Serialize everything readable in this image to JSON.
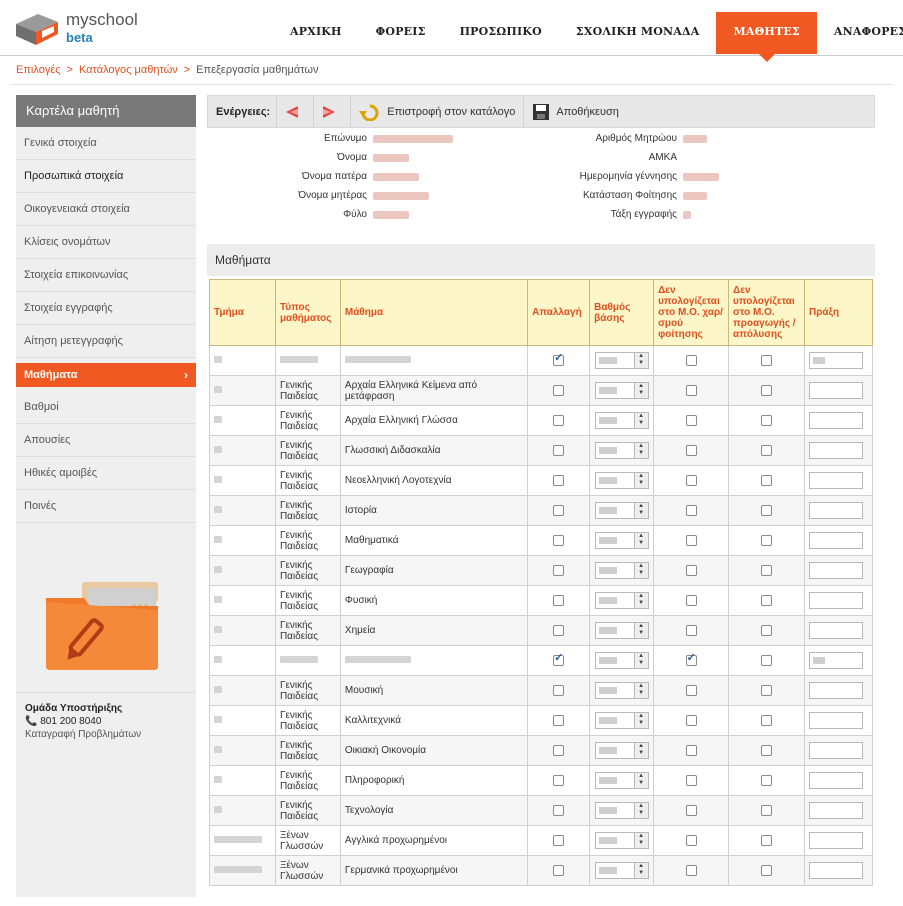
{
  "logo": {
    "name": "myschool",
    "sub": "beta"
  },
  "nav": [
    {
      "label": "ΑΡΧΙΚΗ",
      "active": false
    },
    {
      "label": "ΦΟΡΕΙΣ",
      "active": false
    },
    {
      "label": "ΠΡΟΣΩΠΙΚΟ",
      "active": false
    },
    {
      "label": "ΣΧΟΛΙΚΗ ΜΟΝΑΔΑ",
      "active": false
    },
    {
      "label": "ΜΑΘΗΤΕΣ",
      "active": true
    },
    {
      "label": "ΑΝΑΦΟΡΕΣ",
      "active": false
    }
  ],
  "breadcrumb": [
    "Επιλογές",
    "Κατάλογος μαθητών",
    "Επεξεργασία μαθημάτων"
  ],
  "sidebar": {
    "title": "Καρτέλα μαθητή",
    "items": [
      {
        "label": "Γενικά στοιχεία"
      },
      {
        "label": "Προσωπικά στοιχεία"
      },
      {
        "label": "Οικογενειακά στοιχεία"
      },
      {
        "label": "Κλίσεις ονομάτων"
      },
      {
        "label": "Στοιχεία επικοινωνίας"
      },
      {
        "label": "Στοιχεία εγγραφής"
      },
      {
        "label": "Αίτηση μετεγγραφής"
      },
      {
        "label": "Μαθήματα"
      },
      {
        "label": "Βαθμοί"
      },
      {
        "label": "Απουσίες"
      },
      {
        "label": "Ηθικές αμοιβές"
      },
      {
        "label": "Ποινές"
      }
    ],
    "support": {
      "title": "Ομάδα Υποστήριξης",
      "phone": "801 200 8040",
      "link": "Καταγραφή Προβλημάτων"
    }
  },
  "toolbar": {
    "label": "Ενέργειες:",
    "back_label": "Επιστροφή στον κατάλογο",
    "save_label": "Αποθήκευση"
  },
  "info": {
    "left": [
      "Επώνυμο",
      "Όνομα",
      "Όνομα πατέρα",
      "Όνομα μητέρας",
      "Φύλο"
    ],
    "right": [
      "Αριθμός Μητρώου",
      "ΑΜΚΑ",
      "Ημερομηνία γέννησης",
      "Κατάσταση Φοίτησης",
      "Τάξη εγγραφής"
    ]
  },
  "courses": {
    "title": "Μαθήματα",
    "headers": [
      "Τμήμα",
      "Τύπος μαθήματος",
      "Μάθημα",
      "Απαλλαγή",
      "Βαθμός βάσης",
      "Δεν υπολογίζεται στο Μ.Ο. χαρ/σμού φοίτησης",
      "Δεν υπολογίζεται στο Μ.Ο. προαγωγής / απόλυσης",
      "Πράξη"
    ],
    "rows": [
      {
        "type": "",
        "course": "",
        "exempt": true,
        "nochar": false,
        "nopromo": false,
        "praxi": true
      },
      {
        "type": "Γενικής Παιδείας",
        "course": "Αρχαία Ελληνικά Κείμενα από μετάφραση",
        "exempt": false,
        "nochar": false,
        "nopromo": false,
        "praxi": false
      },
      {
        "type": "Γενικής Παιδείας",
        "course": "Αρχαία Ελληνική Γλώσσα",
        "exempt": false,
        "nochar": false,
        "nopromo": false,
        "praxi": false
      },
      {
        "type": "Γενικής Παιδείας",
        "course": "Γλωσσική Διδασκαλία",
        "exempt": false,
        "nochar": false,
        "nopromo": false,
        "praxi": false
      },
      {
        "type": "Γενικής Παιδείας",
        "course": "Νεοελληνική Λογοτεχνία",
        "exempt": false,
        "nochar": false,
        "nopromo": false,
        "praxi": false
      },
      {
        "type": "Γενικής Παιδείας",
        "course": "Ιστορία",
        "exempt": false,
        "nochar": false,
        "nopromo": false,
        "praxi": false
      },
      {
        "type": "Γενικής Παιδείας",
        "course": "Μαθηματικά",
        "exempt": false,
        "nochar": false,
        "nopromo": false,
        "praxi": false
      },
      {
        "type": "Γενικής Παιδείας",
        "course": "Γεωγραφία",
        "exempt": false,
        "nochar": false,
        "nopromo": false,
        "praxi": false
      },
      {
        "type": "Γενικής Παιδείας",
        "course": "Φυσική",
        "exempt": false,
        "nochar": false,
        "nopromo": false,
        "praxi": false
      },
      {
        "type": "Γενικής Παιδείας",
        "course": "Χημεία",
        "exempt": false,
        "nochar": false,
        "nopromo": false,
        "praxi": false
      },
      {
        "type": "",
        "course": "",
        "exempt": true,
        "nochar": true,
        "nopromo": false,
        "praxi": true
      },
      {
        "type": "Γενικής Παιδείας",
        "course": "Μουσική",
        "exempt": false,
        "nochar": false,
        "nopromo": false,
        "praxi": false
      },
      {
        "type": "Γενικής Παιδείας",
        "course": "Καλλιτεχνικά",
        "exempt": false,
        "nochar": false,
        "nopromo": false,
        "praxi": false
      },
      {
        "type": "Γενικής Παιδείας",
        "course": "Οικιακή Οικονομία",
        "exempt": false,
        "nochar": false,
        "nopromo": false,
        "praxi": false
      },
      {
        "type": "Γενικής Παιδείας",
        "course": "Πληροφορική",
        "exempt": false,
        "nochar": false,
        "nopromo": false,
        "praxi": false
      },
      {
        "type": "Γενικής Παιδείας",
        "course": "Τεχνολογία",
        "exempt": false,
        "nochar": false,
        "nopromo": false,
        "praxi": false
      },
      {
        "type": "Ξένων Γλωσσών",
        "course": "Αγγλικά προχωρημένοι",
        "exempt": false,
        "nochar": false,
        "nopromo": false,
        "praxi": false
      },
      {
        "type": "Ξένων Γλωσσών",
        "course": "Γερμανικά προχωρημένοι",
        "exempt": false,
        "nochar": false,
        "nopromo": false,
        "praxi": false
      }
    ]
  },
  "colors": {
    "accent": "#f05a22",
    "header_bg": "#fcf6c8"
  }
}
